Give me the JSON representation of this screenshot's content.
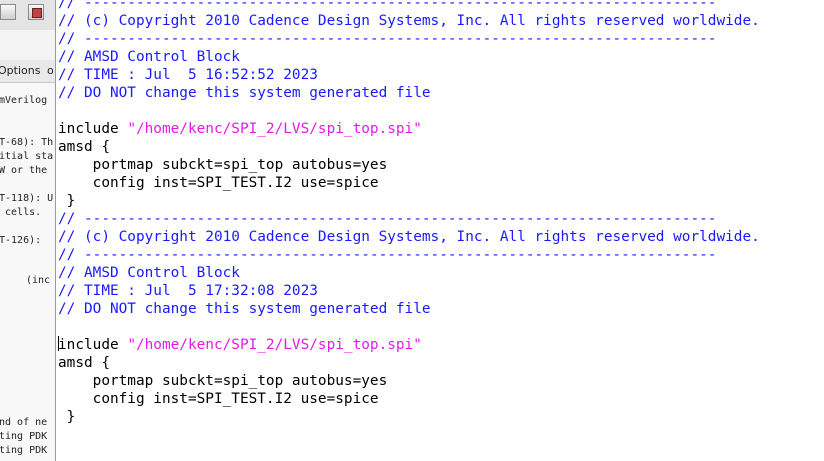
{
  "background_window": {
    "menu": [
      "Options",
      "o"
    ],
    "log_lines": [
      "mVerilog",
      "T-68): Th",
      "itial sta",
      "W or the",
      "T-118): U",
      " cells.",
      "T-126): ",
      "(inc",
      "nd of ne",
      "ting PDK",
      "ting PDK"
    ]
  },
  "editor": {
    "lines": [
      {
        "type": "comment",
        "text": "// -------------------------------------------------------------------------"
      },
      {
        "type": "comment",
        "text": "// (c) Copyright 2010 Cadence Design Systems, Inc. All rights reserved worldwide."
      },
      {
        "type": "comment",
        "text": "// -------------------------------------------------------------------------"
      },
      {
        "type": "comment",
        "text": "// AMSD Control Block"
      },
      {
        "type": "comment",
        "text": "// TIME : Jul  5 16:52:52 2023"
      },
      {
        "type": "comment",
        "text": "// DO NOT change this system generated file"
      },
      {
        "type": "blank",
        "text": ""
      },
      {
        "type": "include",
        "keyword": "include ",
        "path": "\"/home/kenc/SPI_2/LVS/spi_top.spi\""
      },
      {
        "type": "code",
        "text": "amsd {"
      },
      {
        "type": "code",
        "text": "    portmap subckt=spi_top autobus=yes"
      },
      {
        "type": "code",
        "text": "    config inst=SPI_TEST.I2 use=spice"
      },
      {
        "type": "code",
        "text": " }"
      },
      {
        "type": "comment",
        "text": "// -------------------------------------------------------------------------"
      },
      {
        "type": "comment",
        "text": "// (c) Copyright 2010 Cadence Design Systems, Inc. All rights reserved worldwide."
      },
      {
        "type": "comment",
        "text": "// -------------------------------------------------------------------------"
      },
      {
        "type": "comment",
        "text": "// AMSD Control Block"
      },
      {
        "type": "comment",
        "text": "// TIME : Jul  5 17:32:08 2023"
      },
      {
        "type": "comment",
        "text": "// DO NOT change this system generated file"
      },
      {
        "type": "blank",
        "text": ""
      },
      {
        "type": "include",
        "keyword": "include ",
        "path": "\"/home/kenc/SPI_2/LVS/spi_top.spi\"",
        "cursor": true
      },
      {
        "type": "code",
        "text": "amsd {"
      },
      {
        "type": "code",
        "text": "    portmap subckt=spi_top autobus=yes"
      },
      {
        "type": "code",
        "text": "    config inst=SPI_TEST.I2 use=spice"
      },
      {
        "type": "code",
        "text": " }"
      }
    ]
  },
  "colors": {
    "comment": "#1a1aff",
    "string": "#e61be6",
    "text": "#000000"
  }
}
